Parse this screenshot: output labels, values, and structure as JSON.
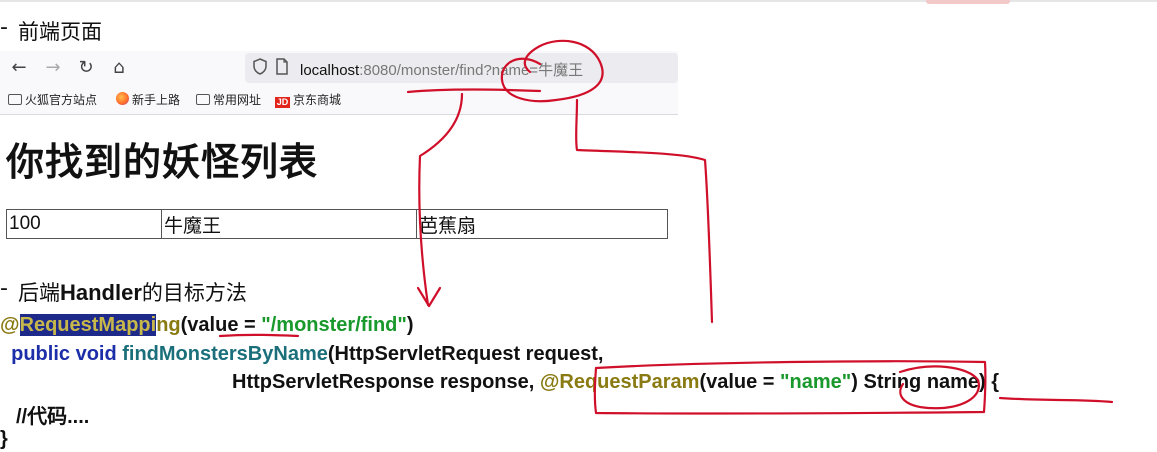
{
  "section1": {
    "bullet": "-",
    "title": "前端页面"
  },
  "browser": {
    "nav": {
      "back_icon": "←",
      "forward_icon": "→",
      "reload_icon": "↻",
      "home_icon": "⌂"
    },
    "url": {
      "host": "localhost",
      "rest": ":8080/monster/find?name=牛魔王"
    },
    "bookmarks": [
      {
        "label": "火狐官方站点",
        "icon": "folder-icon"
      },
      {
        "label": "新手上路",
        "icon": "firefox-icon"
      },
      {
        "label": "常用网址",
        "icon": "folder-icon"
      },
      {
        "label": "京东商城",
        "icon": "jd-icon",
        "icon_text": "JD"
      }
    ]
  },
  "page": {
    "heading": "你找到的妖怪列表",
    "table": {
      "rows": [
        [
          "100",
          "牛魔王",
          "芭蕉扇"
        ]
      ]
    }
  },
  "section2": {
    "bullet": "-",
    "title_pre": "后端",
    "title_bold": "Handler",
    "title_post": "的目标方法"
  },
  "code": {
    "line1": {
      "at": "@",
      "ann_sel": "RequestMappi",
      "ann_rest": "ng",
      "open": "(value = ",
      "str": "\"/monster/find\"",
      "close": ")"
    },
    "line2": {
      "indent": "  ",
      "kw": "public void ",
      "fn": "findMonstersByName",
      "rest": "(HttpServletRequest request,"
    },
    "line3": {
      "pre": "HttpServletResponse response, ",
      "ann": "@RequestParam",
      "open": "(value = ",
      "str": "\"name\"",
      "close": ") String name) {"
    },
    "line4": "//代码....",
    "line5": "}"
  },
  "colors": {
    "annotation": "#8a7a12",
    "keyword": "#1c2ea8",
    "method": "#1a6f7a",
    "string": "#19992b",
    "ink": "#d0102a"
  }
}
